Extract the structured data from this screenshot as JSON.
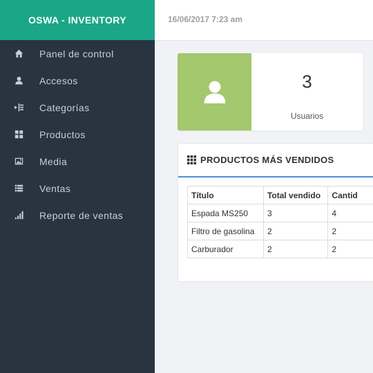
{
  "brand": {
    "title": "OSWA - INVENTORY"
  },
  "header": {
    "datetime": "16/06/2017 7:23 am"
  },
  "sidebar": {
    "items": [
      {
        "label": "Panel de control",
        "icon": "home-icon"
      },
      {
        "label": "Accesos",
        "icon": "user-icon"
      },
      {
        "label": "Categorías",
        "icon": "indent-icon"
      },
      {
        "label": "Productos",
        "icon": "grid-icon"
      },
      {
        "label": "Media",
        "icon": "image-icon"
      },
      {
        "label": "Ventas",
        "icon": "list-icon"
      },
      {
        "label": "Reporte de ventas",
        "icon": "signal-icon"
      }
    ]
  },
  "stats": {
    "users_count": "3",
    "users_label": "Usuarios"
  },
  "top_products": {
    "title": "PRODUCTOS MÁS VENDIDOS",
    "columns": [
      "Título",
      "Total vendido",
      "Cantid"
    ],
    "rows": [
      [
        "Espada MS250",
        "3",
        "4"
      ],
      [
        "Filtro de gasolina",
        "2",
        "2"
      ],
      [
        "Carburador",
        "2",
        "2"
      ]
    ]
  },
  "colors": {
    "brand": "#1ba688",
    "sidebar": "#283440",
    "stat_green": "#a3c86d",
    "accent": "#4a90d9"
  }
}
